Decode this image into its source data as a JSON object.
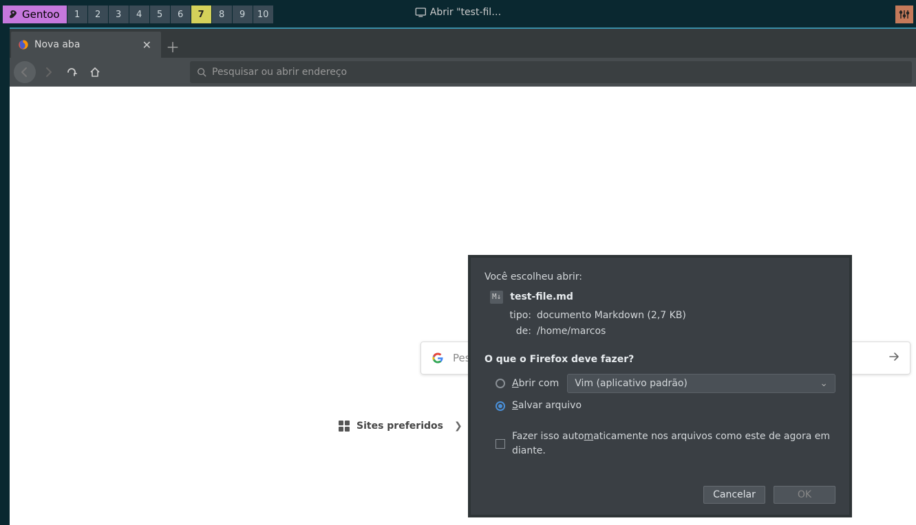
{
  "statusbar": {
    "os_label": "Gentoo",
    "workspaces": [
      "1",
      "2",
      "3",
      "4",
      "5",
      "6",
      "7",
      "8",
      "9",
      "10"
    ],
    "active_workspace": "7",
    "occupied_workspaces": [
      "1",
      "2",
      "3",
      "4",
      "5",
      "6",
      "8",
      "9",
      "10"
    ],
    "window_title": "Abrir \"test-fil…"
  },
  "browser": {
    "tab_title": "Nova aba",
    "urlbar_placeholder": "Pesquisar ou abrir endereço"
  },
  "ntp": {
    "search_placeholder": "Pes",
    "topsites_label": "Sites preferidos"
  },
  "dialog": {
    "intro": "Você escolheu abrir:",
    "file_icon_text": "M↓",
    "filename": "test-file.md",
    "type_label": "tipo:",
    "type_value": "documento Markdown (2,7 KB)",
    "from_label": "de:",
    "from_value": "/home/marcos",
    "question": "O que o Firefox deve fazer?",
    "open_with_pre": "A",
    "open_with_post": "brir com",
    "app_selected": "Vim (aplicativo padrão)",
    "save_pre": "S",
    "save_post": "alvar arquivo",
    "remember_pre": "Fazer isso auto",
    "remember_accel": "m",
    "remember_post": "aticamente nos arquivos como este de agora em diante.",
    "cancel": "Cancelar",
    "ok": "OK"
  }
}
